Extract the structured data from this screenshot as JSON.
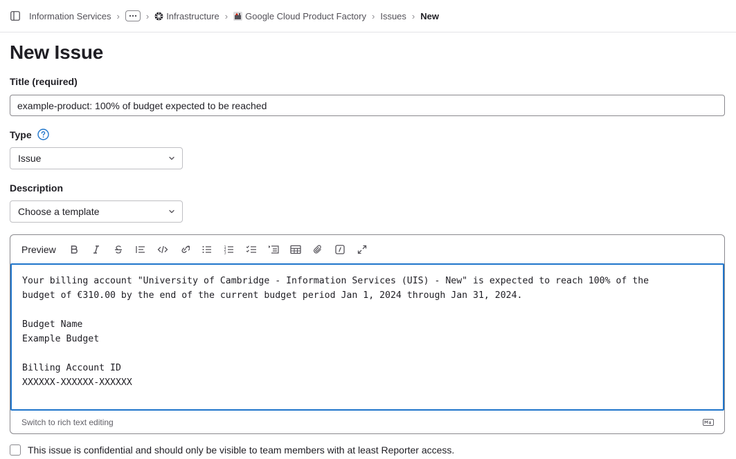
{
  "breadcrumb": {
    "items": [
      {
        "label": "Information Services"
      },
      {
        "label": "Infrastructure",
        "icon": "infrastructure-icon"
      },
      {
        "label": "Google Cloud Product Factory",
        "icon": "project-avatar-icon"
      },
      {
        "label": "Issues"
      },
      {
        "label": "New"
      }
    ]
  },
  "page": {
    "title": "New Issue"
  },
  "form": {
    "title_label": "Title (required)",
    "title_value": "example-product: 100% of budget expected to be reached",
    "type_label": "Type",
    "type_value": "Issue",
    "description_label": "Description",
    "template_placeholder": "Choose a template"
  },
  "editor": {
    "preview_label": "Preview",
    "tools": [
      "bold-icon",
      "italic-icon",
      "strikethrough-icon",
      "quote-icon",
      "code-icon",
      "link-icon",
      "bulleted-list-icon",
      "numbered-list-icon",
      "task-list-icon",
      "collapsible-section-icon",
      "table-icon",
      "attach-file-icon",
      "slash-command-icon",
      "fullscreen-icon"
    ],
    "body": "Your billing account \"University of Cambridge - Information Services (UIS) - New\" is expected to reach 100% of the\nbudget of €310.00 by the end of the current budget period Jan 1, 2024 through Jan 31, 2024.\n\nBudget Name\nExample Budget\n\nBilling Account ID\nXXXXXX-XXXXXX-XXXXXX",
    "switch_label": "Switch to rich text editing"
  },
  "confidential_label": "This issue is confidential and should only be visible to team members with at least Reporter access.",
  "colors": {
    "accent": "#1f75cb",
    "text": "#1f1e24",
    "muted": "#535158"
  }
}
